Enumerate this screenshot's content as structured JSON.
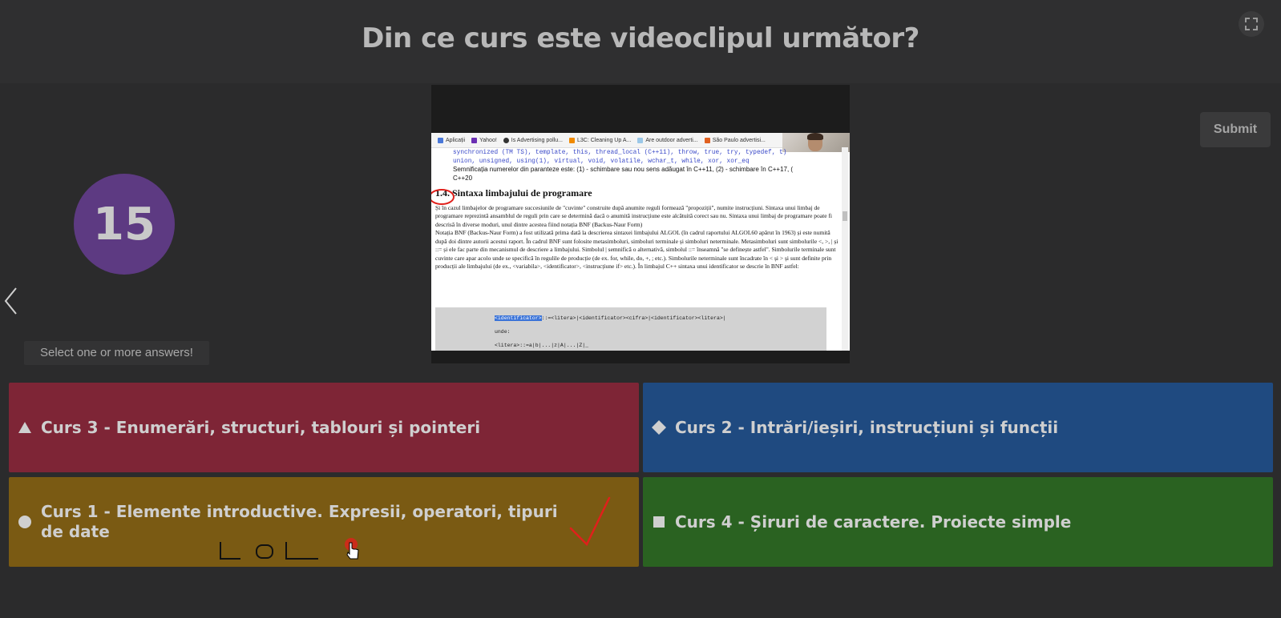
{
  "header": {
    "question": "Din ce curs este videoclipul următor?"
  },
  "timer": {
    "value": "15"
  },
  "hint": "Select one or more answers!",
  "submit_label": "Submit",
  "video": {
    "bookmarks": [
      "Aplicații",
      "Yahoo!",
      "Is Advertising pollu...",
      "L3C: Cleaning Up A...",
      "Are outdoor adverti...",
      "São Paulo advertisi..."
    ],
    "code_line_1": "synchronized (TM TS), template, this, thread_local (C++11), throw, true, try, typedef, t)",
    "code_line_2": "union, unsigned, using(1), virtual, void, volatile, wchar_t, while, xor, xor_eq",
    "note": "Semnificația numerelor din paranteze este: (1) - schimbare sau nou sens adăugat în C++11, (2) - schimbare în C++17, (",
    "note_2": "C++20",
    "section_number": "1.4.",
    "section_title": "Sintaxa limbajului de programare",
    "para1": "Și în cazul limbajelor de programare succesiunile de \"cuvinte\" construite după anumite reguli formează \"propoziții\", numite instrucțiuni. Sintaxa unui limbaj de programare reprezintă ansamblul de reguli prin care se determină dacă o anumită instrucțiune este alcătuită corect sau nu. Sintaxa unui limbaj de programare poate fi descrisă în diverse moduri, unul dintre acestea fiind notația BNF (Backus-Naur Form)",
    "para2": "Notația BNF (Backus-Naur Form) a fost utilizată prima dată la descrierea sintaxei limbajului ALGOL (în cadrul raportului ALGOL60 apărut în 1963) și este numită după doi dintre autorii acestui raport. În cadrul BNF sunt folosite metasimboluri, simboluri terminale și simboluri neterminale. Metasimboluri sunt simbolurile <, >, | și ::= și ele fac parte din mecanismul de descriere a limbajului. Simbolul | semnifică o alternativă, simbolul ::= înseamnă \"se definește astfel\". Simbolurile terminale sunt cuvinte care apar acolo unde se specifică în regulile de producție (de ex. for, while, do, +, ; etc.). Simbolurile neterminale sunt încadrate în < și > și sunt definite prin producții ale limbajului (de ex., <variabila>, <identificator>, <instrucțiune if> etc.). În limbajul C++ sintaxa unui identificator se descrie în BNF astfel:",
    "code_ident": "<identificator>",
    "code_rule": "::=<litera>|<identificator><cifra>|<identificator><litera>|",
    "code_unde": "unde:",
    "code_next": "<litera>::=a|b|...|z|A|...|Z|_"
  },
  "answers": [
    {
      "shape": "triangle",
      "label": "Curs 3 - Enumerări, structuri, tablouri și pointeri",
      "color": "#7e2536"
    },
    {
      "shape": "diamond",
      "label": "Curs 2 - Intrări/ieșiri, instrucțiuni și funcții",
      "color": "#1f4a80"
    },
    {
      "shape": "circle",
      "label": "Curs 1 - Elemente introductive. Expresii, operatori, tipuri de date",
      "color": "#7a5a13"
    },
    {
      "shape": "square",
      "label": "Curs 4 - Șiruri de caractere. Proiecte simple",
      "color": "#2a6221"
    }
  ],
  "annotations": {
    "handwriting": "LOL",
    "ink_color": "#ff1010"
  }
}
